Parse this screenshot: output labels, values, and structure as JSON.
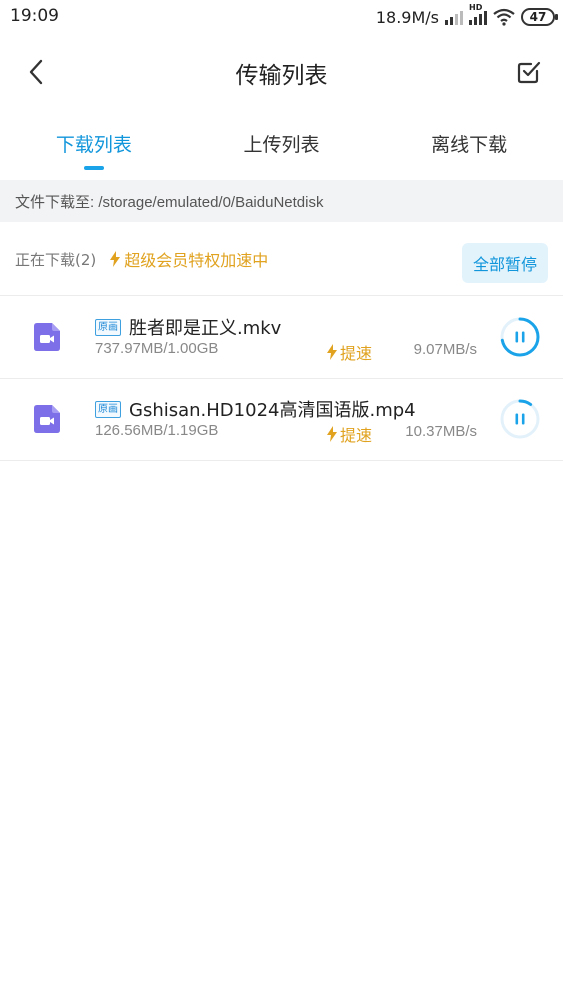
{
  "status_bar": {
    "time": "19:09",
    "net_speed": "18.9M/s",
    "network_label": "HD",
    "battery": "47"
  },
  "header": {
    "title": "传输列表"
  },
  "tabs": [
    {
      "label": "下载列表",
      "active": true
    },
    {
      "label": "上传列表",
      "active": false
    },
    {
      "label": "离线下载",
      "active": false
    }
  ],
  "path_bar": {
    "text": "文件下载至: /storage/emulated/0/BaiduNetdisk"
  },
  "downloading": {
    "count_label": "正在下载(2)",
    "vip_label": "超级会员特权加速中",
    "pause_all_label": "全部暂停"
  },
  "items": [
    {
      "badge": "原画",
      "name": "胜者即是正义.mkv",
      "size": "737.97MB/1.00GB",
      "boost_label": "提速",
      "speed": "9.07MB/s",
      "progress": 0.72
    },
    {
      "badge": "原画",
      "name": "Gshisan.HD1024高清国语版.mp4",
      "size": "126.56MB/1.19GB",
      "boost_label": "提速",
      "speed": "10.37MB/s",
      "progress": 0.1
    }
  ],
  "colors": {
    "accent": "#1296db",
    "vip": "#e0a21f",
    "file_icon": "#7c6fe8"
  }
}
